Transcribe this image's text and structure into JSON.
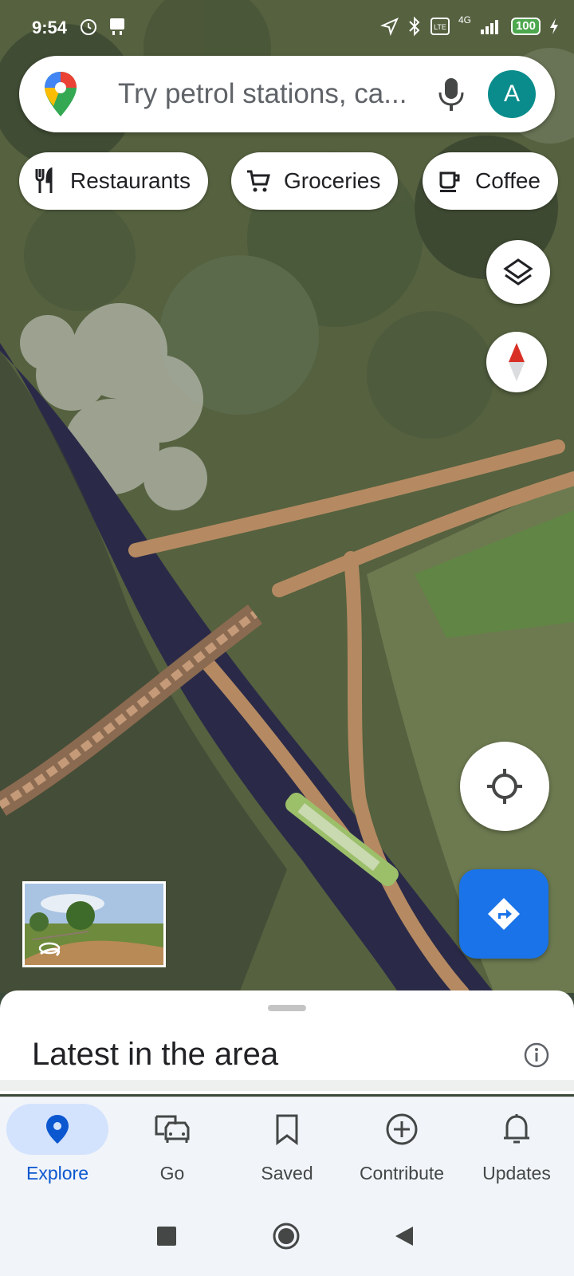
{
  "status_bar": {
    "time": "9:54",
    "battery": "100",
    "network": "4G"
  },
  "search": {
    "placeholder": "Try petrol stations, ca...",
    "avatar_letter": "A"
  },
  "chips": [
    {
      "label": "Restaurants",
      "icon": "fork-knife-icon"
    },
    {
      "label": "Groceries",
      "icon": "cart-icon"
    },
    {
      "label": "Coffee",
      "icon": "coffee-cup-icon"
    }
  ],
  "sheet": {
    "title": "Latest in the area"
  },
  "nav": {
    "items": [
      {
        "label": "Explore",
        "icon": "location-pin-icon",
        "active": true
      },
      {
        "label": "Go",
        "icon": "commute-icon",
        "active": false
      },
      {
        "label": "Saved",
        "icon": "bookmark-icon",
        "active": false
      },
      {
        "label": "Contribute",
        "icon": "add-circle-icon",
        "active": false
      },
      {
        "label": "Updates",
        "icon": "bell-icon",
        "active": false
      }
    ]
  },
  "colors": {
    "accent": "#1a73e8",
    "active_nav_bg": "#d3e3fd",
    "avatar_bg": "#0a8c8c"
  }
}
